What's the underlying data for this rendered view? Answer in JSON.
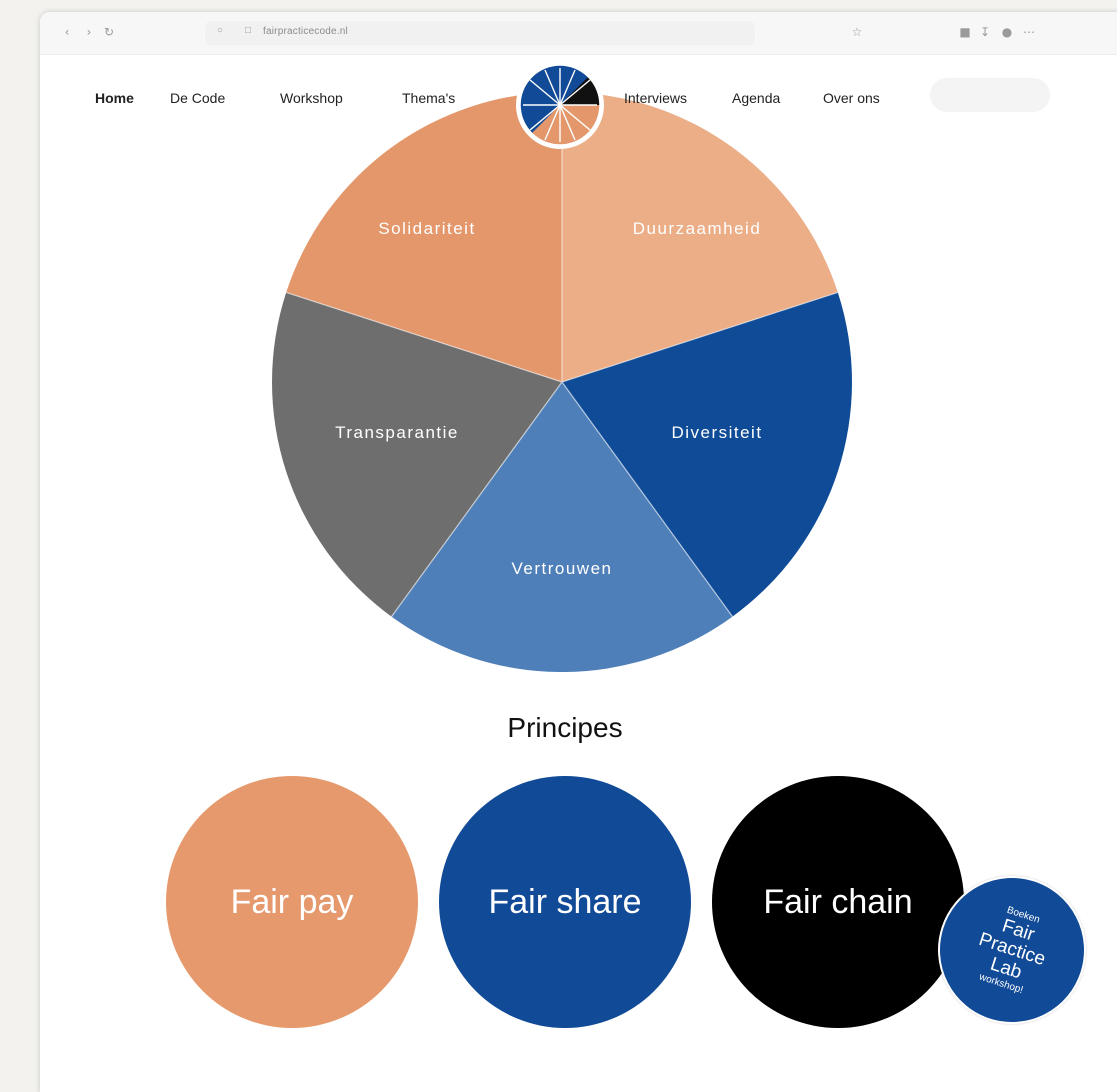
{
  "browser": {
    "url": "fairpracticecode.nl",
    "icons": [
      "back-arrow-icon",
      "forward-arrow-icon",
      "reload-icon",
      "shield-icon",
      "lock-icon",
      "bookmark-star-icon",
      "extension-icon",
      "download-icon",
      "profile-icon",
      "menu-icon"
    ]
  },
  "nav": {
    "items": [
      "Home",
      "De Code",
      "Workshop",
      "Thema's",
      "Interviews",
      "Agenda",
      "Over ons"
    ],
    "active": "Home"
  },
  "pie": {
    "slices": [
      {
        "label": "Solidariteit",
        "color": "#e3976b"
      },
      {
        "label": "Duurzaamheid",
        "color": "#ebae87"
      },
      {
        "label": "Diversiteit",
        "color": "#0f4b97"
      },
      {
        "label": "Vertrouwen",
        "color": "#4e7fb8"
      },
      {
        "label": "Transparantie",
        "color": "#6e6e6e"
      }
    ]
  },
  "principles": {
    "title": "Principes",
    "items": [
      {
        "label": "Fair pay",
        "color": "#e5996d"
      },
      {
        "label": "Fair share",
        "color": "#114a96"
      },
      {
        "label": "Fair chain",
        "color": "#000000"
      }
    ]
  },
  "lab_badge": {
    "line1": "Boeken",
    "line2": "Fair",
    "line3": "Practice",
    "line4": "Lab",
    "line5": "workshop!",
    "color": "#114a96"
  }
}
